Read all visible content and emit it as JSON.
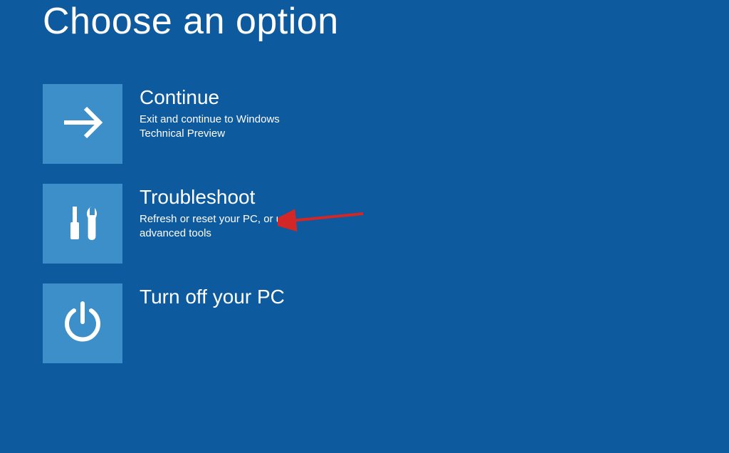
{
  "header": {
    "title": "Choose an option"
  },
  "options": [
    {
      "icon": "arrow-right-icon",
      "title": "Continue",
      "description": "Exit and continue to Windows Technical Preview"
    },
    {
      "icon": "tools-icon",
      "title": "Troubleshoot",
      "description": "Refresh or reset your PC, or use advanced tools"
    },
    {
      "icon": "power-icon",
      "title": "Turn off your PC",
      "description": ""
    }
  ],
  "annotation": {
    "target": "troubleshoot",
    "color": "#d32626"
  }
}
